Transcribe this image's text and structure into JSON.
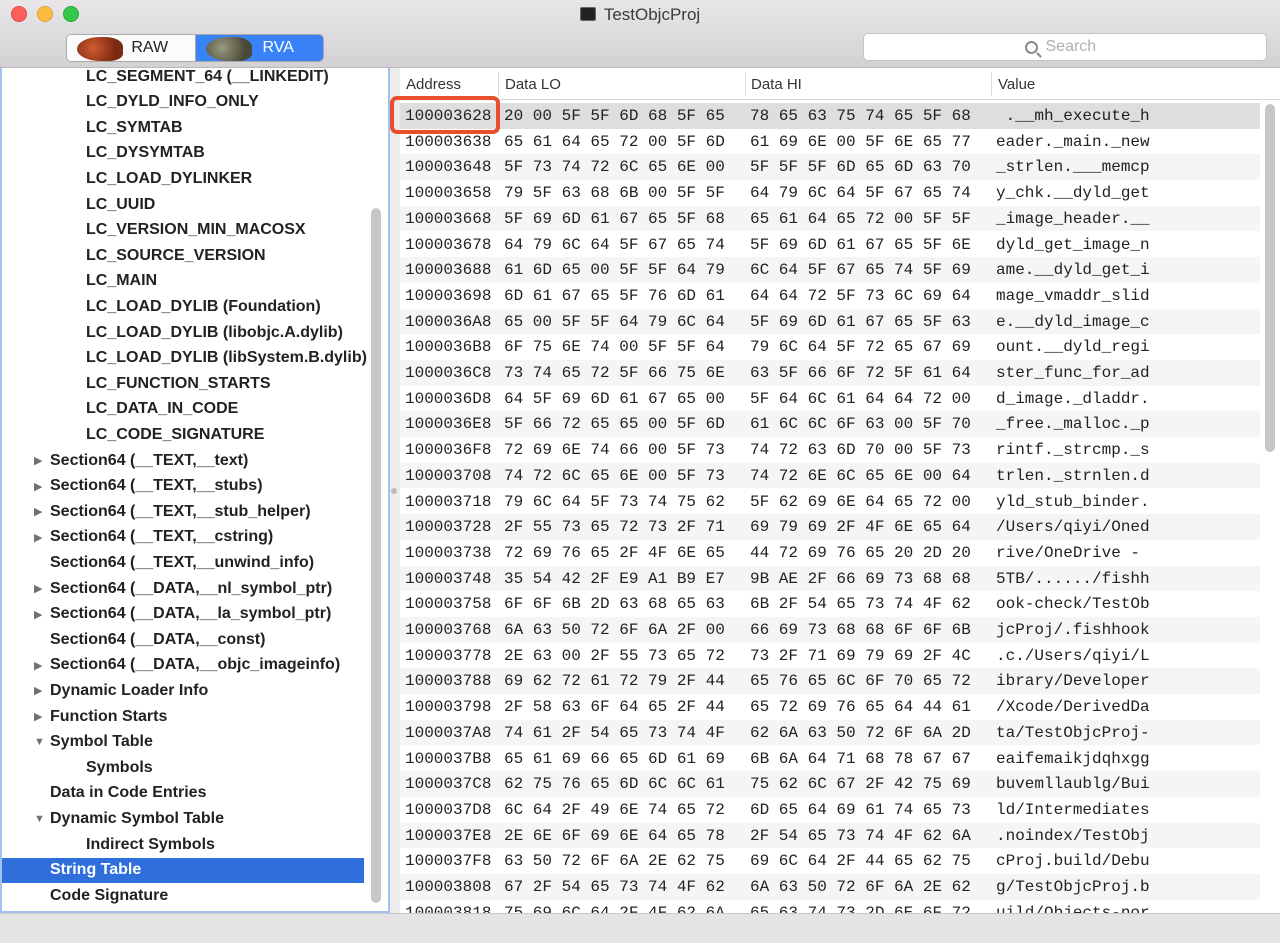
{
  "window": {
    "title": "TestObjcProj"
  },
  "toolbar": {
    "segments": [
      "RAW",
      "RVA"
    ],
    "selected_segment": "RVA",
    "search_placeholder": "Search"
  },
  "sidebar": {
    "items": [
      {
        "label": "LC_SEGMENT_64 (__LINKEDIT)",
        "level": 2,
        "disclosure": "none"
      },
      {
        "label": "LC_DYLD_INFO_ONLY",
        "level": 2,
        "disclosure": "none"
      },
      {
        "label": "LC_SYMTAB",
        "level": 2,
        "disclosure": "none"
      },
      {
        "label": "LC_DYSYMTAB",
        "level": 2,
        "disclosure": "none"
      },
      {
        "label": "LC_LOAD_DYLINKER",
        "level": 2,
        "disclosure": "none"
      },
      {
        "label": "LC_UUID",
        "level": 2,
        "disclosure": "none"
      },
      {
        "label": "LC_VERSION_MIN_MACOSX",
        "level": 2,
        "disclosure": "none"
      },
      {
        "label": "LC_SOURCE_VERSION",
        "level": 2,
        "disclosure": "none"
      },
      {
        "label": "LC_MAIN",
        "level": 2,
        "disclosure": "none"
      },
      {
        "label": "LC_LOAD_DYLIB (Foundation)",
        "level": 2,
        "disclosure": "none"
      },
      {
        "label": "LC_LOAD_DYLIB (libobjc.A.dylib)",
        "level": 2,
        "disclosure": "none"
      },
      {
        "label": "LC_LOAD_DYLIB (libSystem.B.dylib)",
        "level": 2,
        "disclosure": "none"
      },
      {
        "label": "LC_FUNCTION_STARTS",
        "level": 2,
        "disclosure": "none"
      },
      {
        "label": "LC_DATA_IN_CODE",
        "level": 2,
        "disclosure": "none"
      },
      {
        "label": "LC_CODE_SIGNATURE",
        "level": 2,
        "disclosure": "none"
      },
      {
        "label": "Section64 (__TEXT,__text)",
        "level": 1,
        "disclosure": "collapsed"
      },
      {
        "label": "Section64 (__TEXT,__stubs)",
        "level": 1,
        "disclosure": "collapsed"
      },
      {
        "label": "Section64 (__TEXT,__stub_helper)",
        "level": 1,
        "disclosure": "collapsed"
      },
      {
        "label": "Section64 (__TEXT,__cstring)",
        "level": 1,
        "disclosure": "collapsed"
      },
      {
        "label": "Section64 (__TEXT,__unwind_info)",
        "level": 1,
        "disclosure": "none"
      },
      {
        "label": "Section64 (__DATA,__nl_symbol_ptr)",
        "level": 1,
        "disclosure": "collapsed"
      },
      {
        "label": "Section64 (__DATA,__la_symbol_ptr)",
        "level": 1,
        "disclosure": "collapsed"
      },
      {
        "label": "Section64 (__DATA,__const)",
        "level": 1,
        "disclosure": "none"
      },
      {
        "label": "Section64 (__DATA,__objc_imageinfo)",
        "level": 1,
        "disclosure": "collapsed"
      },
      {
        "label": "Dynamic Loader Info",
        "level": 1,
        "disclosure": "collapsed"
      },
      {
        "label": "Function Starts",
        "level": 1,
        "disclosure": "collapsed"
      },
      {
        "label": "Symbol Table",
        "level": 1,
        "disclosure": "expanded"
      },
      {
        "label": "Symbols",
        "level": 2,
        "disclosure": "none"
      },
      {
        "label": "Data in Code Entries",
        "level": 1,
        "disclosure": "none"
      },
      {
        "label": "Dynamic Symbol Table",
        "level": 1,
        "disclosure": "expanded"
      },
      {
        "label": "Indirect Symbols",
        "level": 2,
        "disclosure": "none"
      },
      {
        "label": "String Table",
        "level": 1,
        "disclosure": "none",
        "selected": true
      },
      {
        "label": "Code Signature",
        "level": 1,
        "disclosure": "none"
      }
    ]
  },
  "table": {
    "columns": [
      "Address",
      "Data LO",
      "Data HI",
      "Value"
    ],
    "rows": [
      [
        "100003628",
        "20 00 5F 5F 6D 68 5F 65",
        "78 65 63 75 74 65 5F 68",
        " .__mh_execute_h"
      ],
      [
        "100003638",
        "65 61 64 65 72 00 5F 6D",
        "61 69 6E 00 5F 6E 65 77",
        "eader._main._new"
      ],
      [
        "100003648",
        "5F 73 74 72 6C 65 6E 00",
        "5F 5F 5F 6D 65 6D 63 70",
        "_strlen.___memcp"
      ],
      [
        "100003658",
        "79 5F 63 68 6B 00 5F 5F",
        "64 79 6C 64 5F 67 65 74",
        "y_chk.__dyld_get"
      ],
      [
        "100003668",
        "5F 69 6D 61 67 65 5F 68",
        "65 61 64 65 72 00 5F 5F",
        "_image_header.__"
      ],
      [
        "100003678",
        "64 79 6C 64 5F 67 65 74",
        "5F 69 6D 61 67 65 5F 6E",
        "dyld_get_image_n"
      ],
      [
        "100003688",
        "61 6D 65 00 5F 5F 64 79",
        "6C 64 5F 67 65 74 5F 69",
        "ame.__dyld_get_i"
      ],
      [
        "100003698",
        "6D 61 67 65 5F 76 6D 61",
        "64 64 72 5F 73 6C 69 64",
        "mage_vmaddr_slid"
      ],
      [
        "1000036A8",
        "65 00 5F 5F 64 79 6C 64",
        "5F 69 6D 61 67 65 5F 63",
        "e.__dyld_image_c"
      ],
      [
        "1000036B8",
        "6F 75 6E 74 00 5F 5F 64",
        "79 6C 64 5F 72 65 67 69",
        "ount.__dyld_regi"
      ],
      [
        "1000036C8",
        "73 74 65 72 5F 66 75 6E",
        "63 5F 66 6F 72 5F 61 64",
        "ster_func_for_ad"
      ],
      [
        "1000036D8",
        "64 5F 69 6D 61 67 65 00",
        "5F 64 6C 61 64 64 72 00",
        "d_image._dladdr."
      ],
      [
        "1000036E8",
        "5F 66 72 65 65 00 5F 6D",
        "61 6C 6C 6F 63 00 5F 70",
        "_free._malloc._p"
      ],
      [
        "1000036F8",
        "72 69 6E 74 66 00 5F 73",
        "74 72 63 6D 70 00 5F 73",
        "rintf._strcmp._s"
      ],
      [
        "100003708",
        "74 72 6C 65 6E 00 5F 73",
        "74 72 6E 6C 65 6E 00 64",
        "trlen._strnlen.d"
      ],
      [
        "100003718",
        "79 6C 64 5F 73 74 75 62",
        "5F 62 69 6E 64 65 72 00",
        "yld_stub_binder."
      ],
      [
        "100003728",
        "2F 55 73 65 72 73 2F 71",
        "69 79 69 2F 4F 6E 65 64",
        "/Users/qiyi/Oned"
      ],
      [
        "100003738",
        "72 69 76 65 2F 4F 6E 65",
        "44 72 69 76 65 20 2D 20",
        "rive/OneDrive - "
      ],
      [
        "100003748",
        "35 54 42 2F E9 A1 B9 E7",
        "9B AE 2F 66 69 73 68 68",
        "5TB/....../fishh"
      ],
      [
        "100003758",
        "6F 6F 6B 2D 63 68 65 63",
        "6B 2F 54 65 73 74 4F 62",
        "ook-check/TestOb"
      ],
      [
        "100003768",
        "6A 63 50 72 6F 6A 2F 00",
        "66 69 73 68 68 6F 6F 6B",
        "jcProj/.fishhook"
      ],
      [
        "100003778",
        "2E 63 00 2F 55 73 65 72",
        "73 2F 71 69 79 69 2F 4C",
        ".c./Users/qiyi/L"
      ],
      [
        "100003788",
        "69 62 72 61 72 79 2F 44",
        "65 76 65 6C 6F 70 65 72",
        "ibrary/Developer"
      ],
      [
        "100003798",
        "2F 58 63 6F 64 65 2F 44",
        "65 72 69 76 65 64 44 61",
        "/Xcode/DerivedDa"
      ],
      [
        "1000037A8",
        "74 61 2F 54 65 73 74 4F",
        "62 6A 63 50 72 6F 6A 2D",
        "ta/TestObjcProj-"
      ],
      [
        "1000037B8",
        "65 61 69 66 65 6D 61 69",
        "6B 6A 64 71 68 78 67 67",
        "eaifemaikjdqhxgg"
      ],
      [
        "1000037C8",
        "62 75 76 65 6D 6C 6C 61",
        "75 62 6C 67 2F 42 75 69",
        "buvemllaublg/Bui"
      ],
      [
        "1000037D8",
        "6C 64 2F 49 6E 74 65 72",
        "6D 65 64 69 61 74 65 73",
        "ld/Intermediates"
      ],
      [
        "1000037E8",
        "2E 6E 6F 69 6E 64 65 78",
        "2F 54 65 73 74 4F 62 6A",
        ".noindex/TestObj"
      ],
      [
        "1000037F8",
        "63 50 72 6F 6A 2E 62 75",
        "69 6C 64 2F 44 65 62 75",
        "cProj.build/Debu"
      ],
      [
        "100003808",
        "67 2F 54 65 73 74 4F 62",
        "6A 63 50 72 6F 6A 2E 62",
        "g/TestObjcProj.b"
      ],
      [
        "100003818",
        "75 69 6C 64 2F 4F 62 6A",
        "65 63 74 73 2D 6E 6F 72",
        "uild/Objects-nor"
      ]
    ],
    "highlighted_row": 0
  },
  "colors": {
    "selection": "#2f6fdb",
    "highlight_box": "#e8502d",
    "segment_active": "#3a82f7"
  }
}
